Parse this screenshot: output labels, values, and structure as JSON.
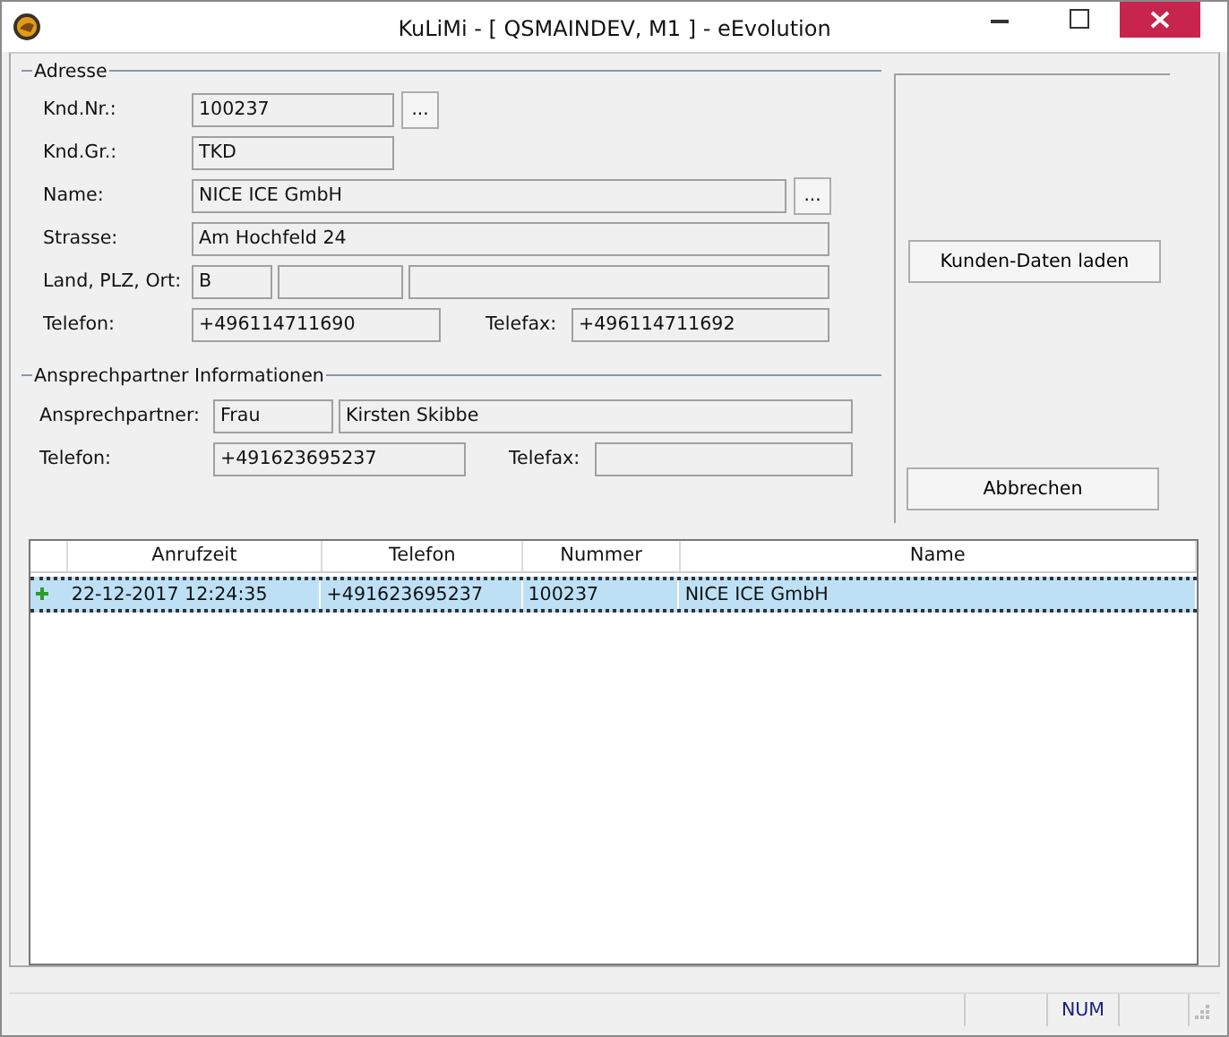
{
  "window": {
    "title": "KuLiMi - [ QSMAINDEV, M1 ]  -  eEvolution"
  },
  "address": {
    "legend": "Adresse",
    "customer_no": {
      "label": "Knd.Nr.:",
      "value": "100237",
      "button": "..."
    },
    "customer_group": {
      "label": "Knd.Gr.:",
      "value": "TKD"
    },
    "name": {
      "label": "Name:",
      "value": "NICE ICE GmbH",
      "button": "..."
    },
    "street": {
      "label": "Strasse:",
      "value": "Am Hochfeld 24"
    },
    "country_zip_city": {
      "label": "Land, PLZ, Ort:",
      "country": "B"
    },
    "phone": {
      "label": "Telefon:",
      "value": "+496114711690"
    },
    "fax": {
      "label": "Telefax:",
      "value": "+496114711692"
    }
  },
  "contact": {
    "legend": "Ansprechpartner Informationen",
    "person": {
      "label": "Ansprechpartner:",
      "salutation": "Frau",
      "name": "Kirsten Skibbe"
    },
    "phone": {
      "label": "Telefon:",
      "value": "+491623695237"
    },
    "fax": {
      "label": "Telefax:"
    }
  },
  "buttons": {
    "load": "Kunden-Daten laden",
    "cancel": "Abbrechen"
  },
  "table": {
    "columns": [
      "Anrufzeit",
      "Telefon",
      "Nummer",
      "Name"
    ],
    "rows": [
      {
        "selected": true,
        "cells": [
          "22-12-2017 12:24:35",
          "+491623695237",
          "100237",
          "NICE ICE GmbH"
        ]
      }
    ]
  },
  "status_bar": {
    "num_indicator": "NUM"
  }
}
